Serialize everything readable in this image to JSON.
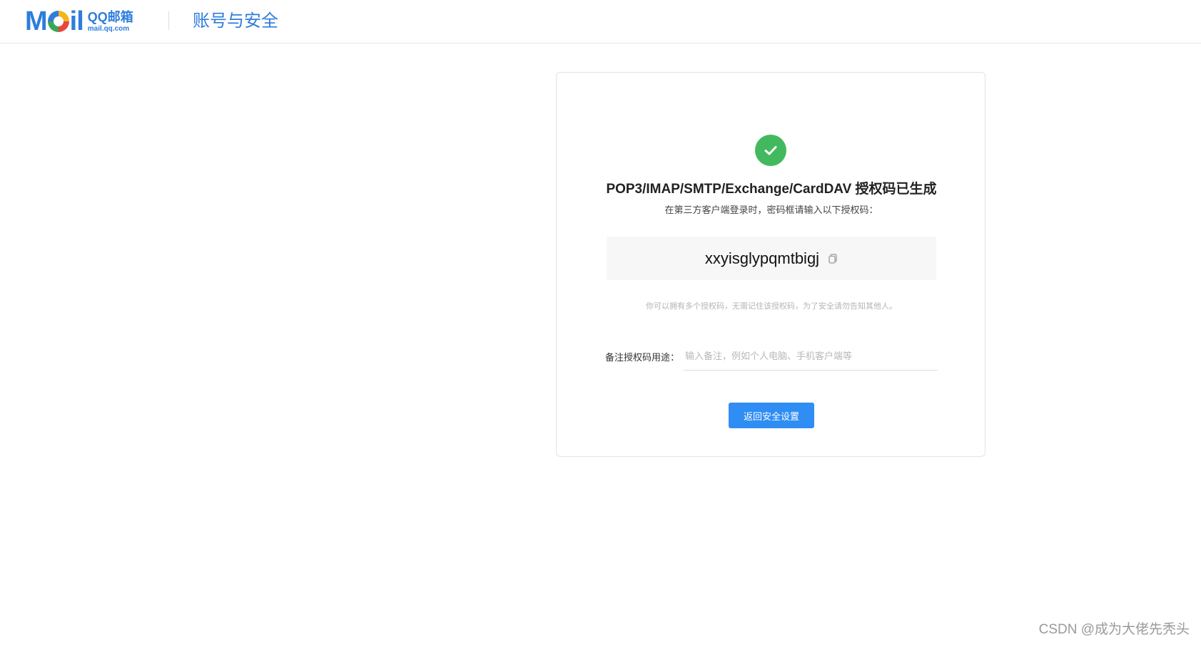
{
  "header": {
    "logo_word_left": "M",
    "logo_word_right": "il",
    "logo_brand": "QQ邮箱",
    "logo_domain": "mail.qq.com",
    "title": "账号与安全"
  },
  "card": {
    "status_icon": "check-circle-icon",
    "title": "POP3/IMAP/SMTP/Exchange/CardDAV 授权码已生成",
    "subtitle": "在第三方客户端登录时，密码框请输入以下授权码：",
    "auth_code": "xxyisglypqmtbigj",
    "copy_icon": "copy-icon",
    "hint": "你可以拥有多个授权码，无需记住该授权码，为了安全请勿告知其他人。",
    "note_label": "备注授权码用途：",
    "note_placeholder": "输入备注，例如个人电脑、手机客户端等",
    "note_value": "",
    "back_button": "返回安全设置"
  },
  "watermark": "CSDN @成为大佬先秃头",
  "colors": {
    "brand_blue": "#2e7ddc",
    "success_green": "#42b95e",
    "button_blue": "#2f8df4"
  }
}
